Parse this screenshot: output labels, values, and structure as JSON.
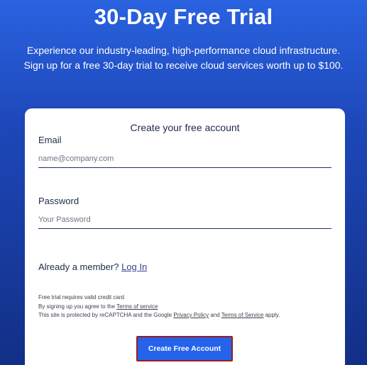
{
  "hero": {
    "title": "30-Day Free Trial",
    "subtitle_line1": "Experience our industry-leading, high-performance cloud infrastructure.",
    "subtitle_line2": "Sign up for a free 30-day trial to receive cloud services worth up to $100."
  },
  "form": {
    "title": "Create your free account",
    "email": {
      "label": "Email",
      "placeholder": "name@company.com",
      "value": ""
    },
    "password": {
      "label": "Password",
      "placeholder": "Your Password",
      "value": ""
    },
    "member_prompt": "Already a member?",
    "login_link": "Log In",
    "fine_print": {
      "line1": "Free trial requires valid credit card",
      "line2_prefix": "By signing up you agree to the",
      "terms_link": "Terms of service",
      "line3_prefix": "This site is protected by reCAPTCHA and the Google",
      "privacy_link": "Privacy Policy",
      "and_text": "and",
      "google_terms_link": "Terms of Service",
      "apply_text": "apply."
    },
    "submit_label": "Create Free Account"
  },
  "colors": {
    "background_top": "#2a62e0",
    "background_bottom": "#122f86",
    "button": "#2563eb",
    "button_focus_border": "#9b1c1c"
  }
}
